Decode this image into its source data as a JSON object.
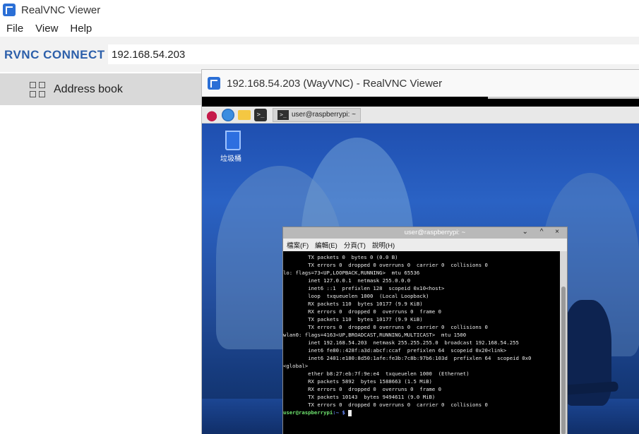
{
  "app": {
    "title": "RealVNC Viewer"
  },
  "menu": [
    "File",
    "View",
    "Help"
  ],
  "brand": "RVNC CONNECT",
  "address": {
    "value": "192.168.54.203"
  },
  "sidebar": {
    "tab_label": "Address book"
  },
  "remote": {
    "title": "192.168.54.203 (WayVNC) - RealVNC Viewer",
    "taskbar": {
      "task_label": "user@raspberrypi: ~"
    },
    "desktop": {
      "trash_label": "垃圾桶"
    },
    "terminal": {
      "title": "user@raspberrypi: ~",
      "controls": "⌄ ^ ×",
      "menu": [
        "檔案(F)",
        "編輯(E)",
        "分頁(T)",
        "說明(H)"
      ],
      "lines": [
        "        TX packets 0  bytes 0 (0.0 B)",
        "        TX errors 0  dropped 0 overruns 0  carrier 0  collisions 0",
        "",
        "lo: flags=73<UP,LOOPBACK,RUNNING>  mtu 65536",
        "        inet 127.0.0.1  netmask 255.0.0.0",
        "        inet6 ::1  prefixlen 128  scopeid 0x10<host>",
        "        loop  txqueuelen 1000  (Local Loopback)",
        "        RX packets 110  bytes 10177 (9.9 KiB)",
        "        RX errors 0  dropped 0  overruns 0  frame 0",
        "        TX packets 110  bytes 10177 (9.9 KiB)",
        "        TX errors 0  dropped 0 overruns 0  carrier 0  collisions 0",
        "",
        "wlan0: flags=4163<UP,BROADCAST,RUNNING,MULTICAST>  mtu 1500",
        "        inet 192.168.54.203  netmask 255.255.255.0  broadcast 192.168.54.255",
        "        inet6 fe80::428f:a3d:abcf:ccaf  prefixlen 64  scopeid 0x20<link>",
        "        inet6 2401:e180:8d50:1afe:fe3b:7c8b:97b6:103d  prefixlen 64  scopeid 0x0",
        "<global>",
        "        ether b8:27:eb:7f:9e:e4  txqueuelen 1000  (Ethernet)",
        "        RX packets 5892  bytes 1588663 (1.5 MiB)",
        "        RX errors 0  dropped 0  overruns 0  frame 0",
        "        TX packets 10143  bytes 9494611 (9.0 MiB)",
        "        TX errors 0  dropped 0 overruns 0  carrier 0  collisions 0",
        ""
      ],
      "prompt_user": "user@raspberrypi",
      "prompt_path": ":~ $"
    }
  }
}
